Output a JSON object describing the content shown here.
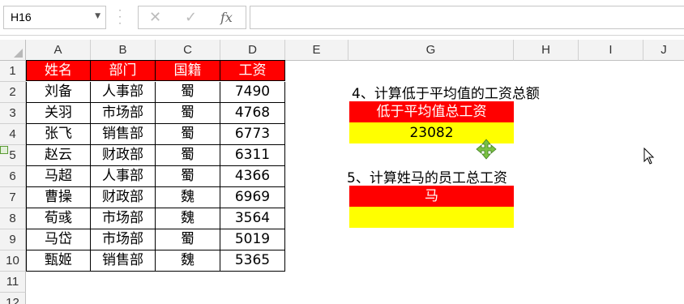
{
  "name_box": {
    "value": "H16"
  },
  "formula_bar": {
    "cancel": "✕",
    "enter": "✓",
    "fx": "fx",
    "value": ""
  },
  "columns": [
    "A",
    "B",
    "C",
    "D",
    "E",
    "G",
    "H",
    "I",
    "J"
  ],
  "rows": [
    "1",
    "2",
    "3",
    "4",
    "5",
    "6",
    "7",
    "8",
    "9",
    "10",
    "11",
    "12"
  ],
  "table": {
    "headers": [
      "姓名",
      "部门",
      "国籍",
      "工资"
    ],
    "rows": [
      [
        "刘备",
        "人事部",
        "蜀",
        "7490"
      ],
      [
        "关羽",
        "市场部",
        "蜀",
        "4768"
      ],
      [
        "张飞",
        "销售部",
        "蜀",
        "6773"
      ],
      [
        "赵云",
        "财政部",
        "蜀",
        "6311"
      ],
      [
        "马超",
        "人事部",
        "蜀",
        "4366"
      ],
      [
        "曹操",
        "财政部",
        "魏",
        "6969"
      ],
      [
        "荀彧",
        "市场部",
        "魏",
        "3564"
      ],
      [
        "马岱",
        "市场部",
        "蜀",
        "5019"
      ],
      [
        "甄姬",
        "销售部",
        "魏",
        "5365"
      ]
    ]
  },
  "task4": {
    "title": "4、计算低于平均值的工资总额",
    "header": "低于平均值总工资",
    "result": "23082"
  },
  "task5": {
    "title": "5、计算姓马的员工总工资",
    "header": "马",
    "result": ""
  },
  "colors": {
    "header_red": "#ff0000",
    "result_yellow": "#ffff00",
    "move_icon_green": "#7ac143"
  }
}
